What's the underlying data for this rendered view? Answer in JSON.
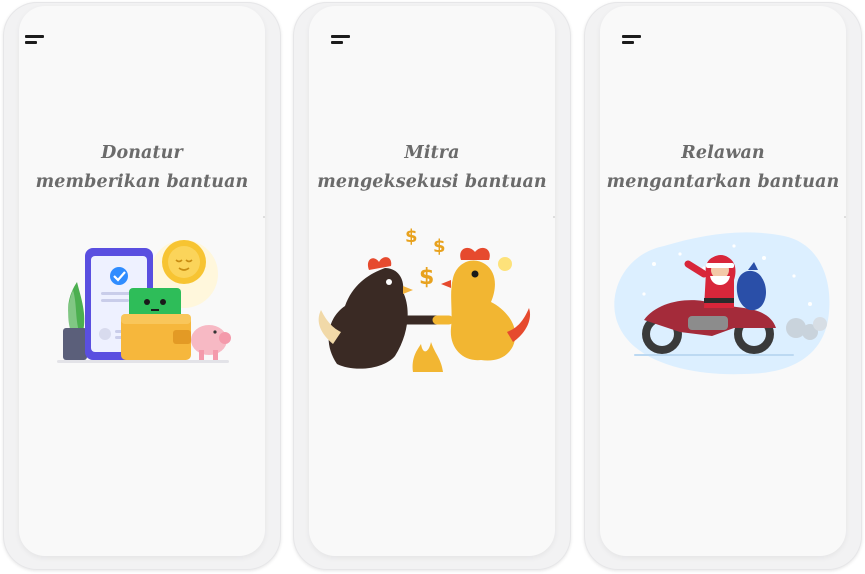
{
  "cards": [
    {
      "caption_line1": "Donatur",
      "caption_line2": "memberikan bantuan",
      "illustration_icon": "wallet-phone-coin-piggybank-icon"
    },
    {
      "caption_line1": "Mitra",
      "caption_line2": "mengeksekusi bantuan",
      "illustration_icon": "roosters-handshake-icon"
    },
    {
      "caption_line1": "Relawan",
      "caption_line2": "mengantarkan bantuan",
      "illustration_icon": "santa-motorcycle-icon"
    }
  ],
  "colors": {
    "caption": "#6b6b6b",
    "menu_icon": "#1c1c1c",
    "phone_frame": "#f2f2f3",
    "screen": "#f9f9f9"
  }
}
